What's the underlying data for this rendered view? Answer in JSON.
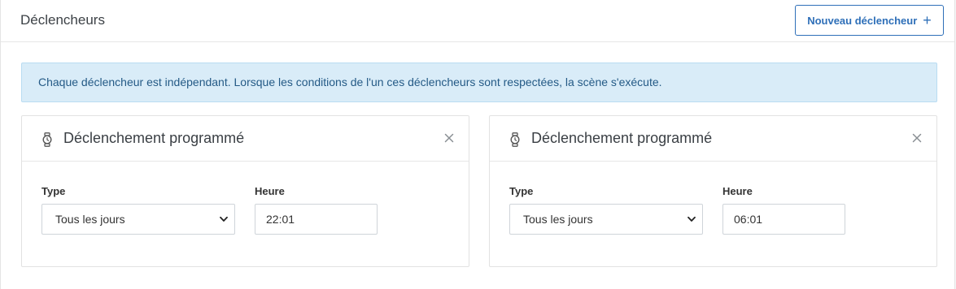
{
  "header": {
    "title": "Déclencheurs",
    "new_button_label": "Nouveau déclencheur",
    "new_button_icon": "plus-icon"
  },
  "info": {
    "text": "Chaque déclencheur est indépendant. Lorsque les conditions de l'un ces déclencheurs sont respectées, la scène s'exécute."
  },
  "triggers": [
    {
      "title": "Déclenchement programmé",
      "icon": "watch-icon",
      "type_label": "Type",
      "type_value": "Tous les jours",
      "time_label": "Heure",
      "time_value": "22:01"
    },
    {
      "title": "Déclenchement programmé",
      "icon": "watch-icon",
      "type_label": "Type",
      "type_value": "Tous les jours",
      "time_label": "Heure",
      "time_value": "06:01"
    }
  ],
  "colors": {
    "accent": "#2e6fb8",
    "info_background": "#d9ecf8",
    "info_text": "#245a86"
  }
}
